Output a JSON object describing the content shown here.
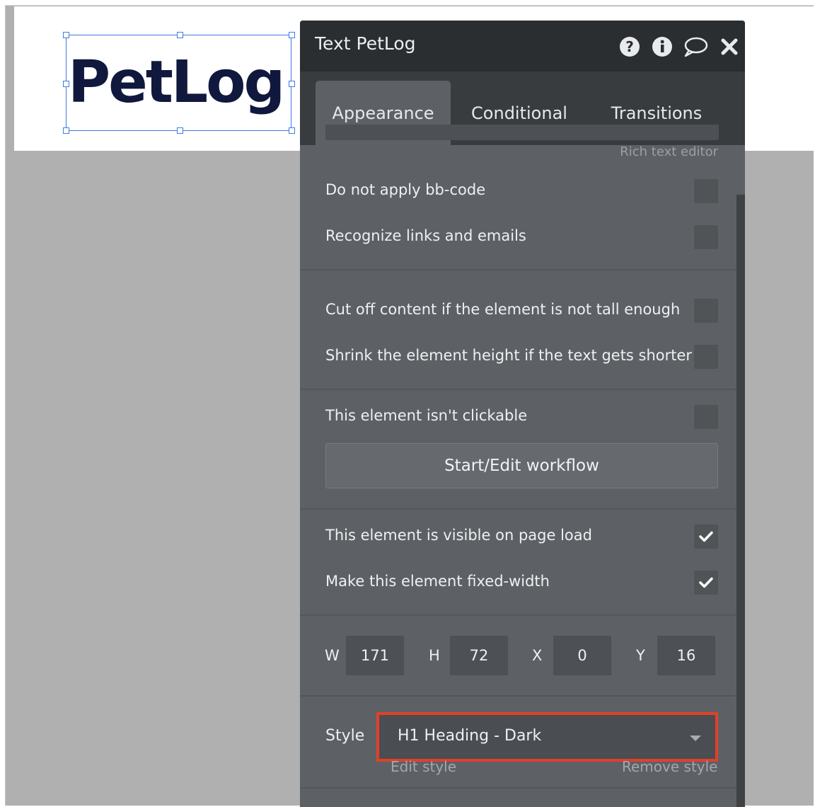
{
  "canvas": {
    "logo_text": "PetLog"
  },
  "panel": {
    "title": "Text PetLog",
    "icons": [
      "help-icon",
      "info-icon",
      "comment-icon",
      "close-icon"
    ],
    "tabs": [
      {
        "label": "Appearance",
        "active": true
      },
      {
        "label": "Conditional",
        "active": false
      },
      {
        "label": "Transitions",
        "active": false
      }
    ],
    "rich_text_editor_link": "Rich text editor",
    "options": [
      {
        "label": "Do not apply bb-code",
        "checked": false
      },
      {
        "label": "Recognize links and emails",
        "checked": false
      },
      {
        "label": "Cut off content if the element is not tall enough",
        "checked": false
      },
      {
        "label": "Shrink the element height if the text gets shorter",
        "checked": false
      },
      {
        "label": "This element isn't clickable",
        "checked": false
      },
      {
        "label": "This element is visible on page load",
        "checked": true
      },
      {
        "label": "Make this element fixed-width",
        "checked": true
      }
    ],
    "workflow_button": "Start/Edit workflow",
    "dimensions": {
      "w_label": "W",
      "w_value": "171",
      "h_label": "H",
      "h_value": "72",
      "x_label": "X",
      "x_value": "0",
      "y_label": "Y",
      "y_value": "16"
    },
    "style": {
      "label": "Style",
      "selected": "H1 Heading - Dark",
      "edit_link": "Edit style",
      "remove_link": "Remove style"
    }
  },
  "colors": {
    "header_bg": "#2b2e31",
    "panel_bg": "#5d6165",
    "highlight": "#e1402a",
    "logo": "#10183d",
    "selection": "#3e7be6"
  }
}
